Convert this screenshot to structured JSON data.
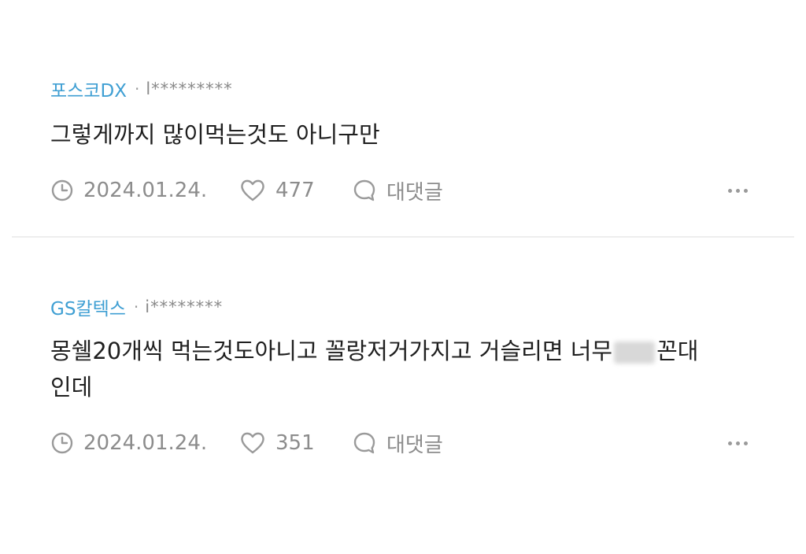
{
  "comments": [
    {
      "company": "포스코DX",
      "separator": "·",
      "user_id": "l*********",
      "text": "그렇게까지 많이먹는것도 아니구만",
      "date": "2024.01.24.",
      "likes": "477",
      "reply_label": "대댓글"
    },
    {
      "company": "GS칼텍스",
      "separator": "·",
      "user_id": "i********",
      "text_before_blur": "몽쉘20개씩 먹는것도아니고 꼴랑저거가지고 거슬리면 너무",
      "text_after_blur": "꼰대",
      "text_line2": "인데",
      "date": "2024.01.24.",
      "likes": "351",
      "reply_label": "대댓글"
    }
  ],
  "icons": {
    "date": "clock-icon",
    "like": "heart-icon",
    "reply": "speech-bubble-icon",
    "more": "more-dots-icon"
  },
  "colors": {
    "company": "#3f9fd3",
    "muted": "#8c8c8c",
    "text": "#1f1f1f",
    "divider": "#eeeeee"
  }
}
